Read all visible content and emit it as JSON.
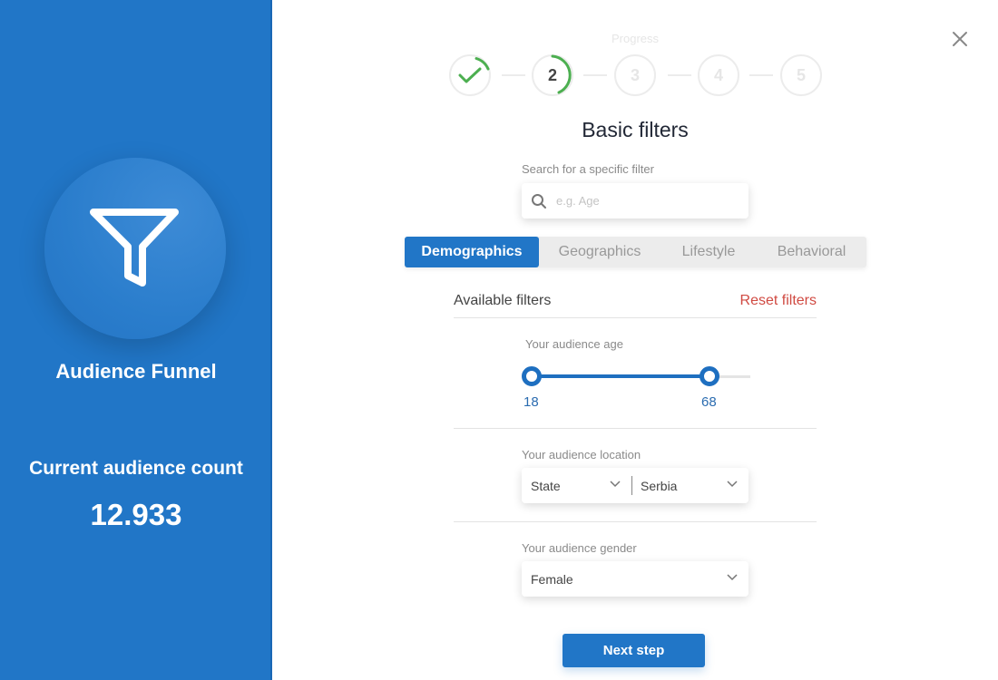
{
  "sidebar": {
    "icon": "funnel-icon",
    "app_name": "Audience Funnel",
    "count_label": "Current audience count",
    "count_value": "12.933"
  },
  "close_icon": "close-icon",
  "progress": {
    "label": "Progress",
    "current_step": 2,
    "total_steps": 5,
    "steps": [
      {
        "label": "1",
        "state": "completed",
        "icon": "checkmark-icon"
      },
      {
        "label": "2",
        "state": "current"
      },
      {
        "label": "3",
        "state": "upcoming"
      },
      {
        "label": "4",
        "state": "upcoming"
      },
      {
        "label": "5",
        "state": "upcoming"
      }
    ],
    "accent_color": "#4caf50"
  },
  "main": {
    "title": "Basic filters",
    "search": {
      "label": "Search for a specific filter",
      "placeholder": "e.g. Age",
      "value": "",
      "icon": "search-icon"
    },
    "tabs": [
      {
        "label": "Demographics",
        "active": true
      },
      {
        "label": "Geographics",
        "active": false
      },
      {
        "label": "Lifestyle",
        "active": false
      },
      {
        "label": "Behavioral",
        "active": false
      }
    ],
    "filters_title": "Available filters",
    "reset_label": "Reset filters",
    "age": {
      "label": "Your audience age",
      "min_value": "18",
      "max_value": "68"
    },
    "location": {
      "label": "Your audience location",
      "type_value": "State",
      "country_value": "Serbia"
    },
    "gender": {
      "label": "Your audience gender",
      "value": "Female"
    },
    "next_label": "Next step"
  },
  "colors": {
    "primary": "#2176c7",
    "danger": "#d04a42",
    "success": "#4caf50"
  }
}
